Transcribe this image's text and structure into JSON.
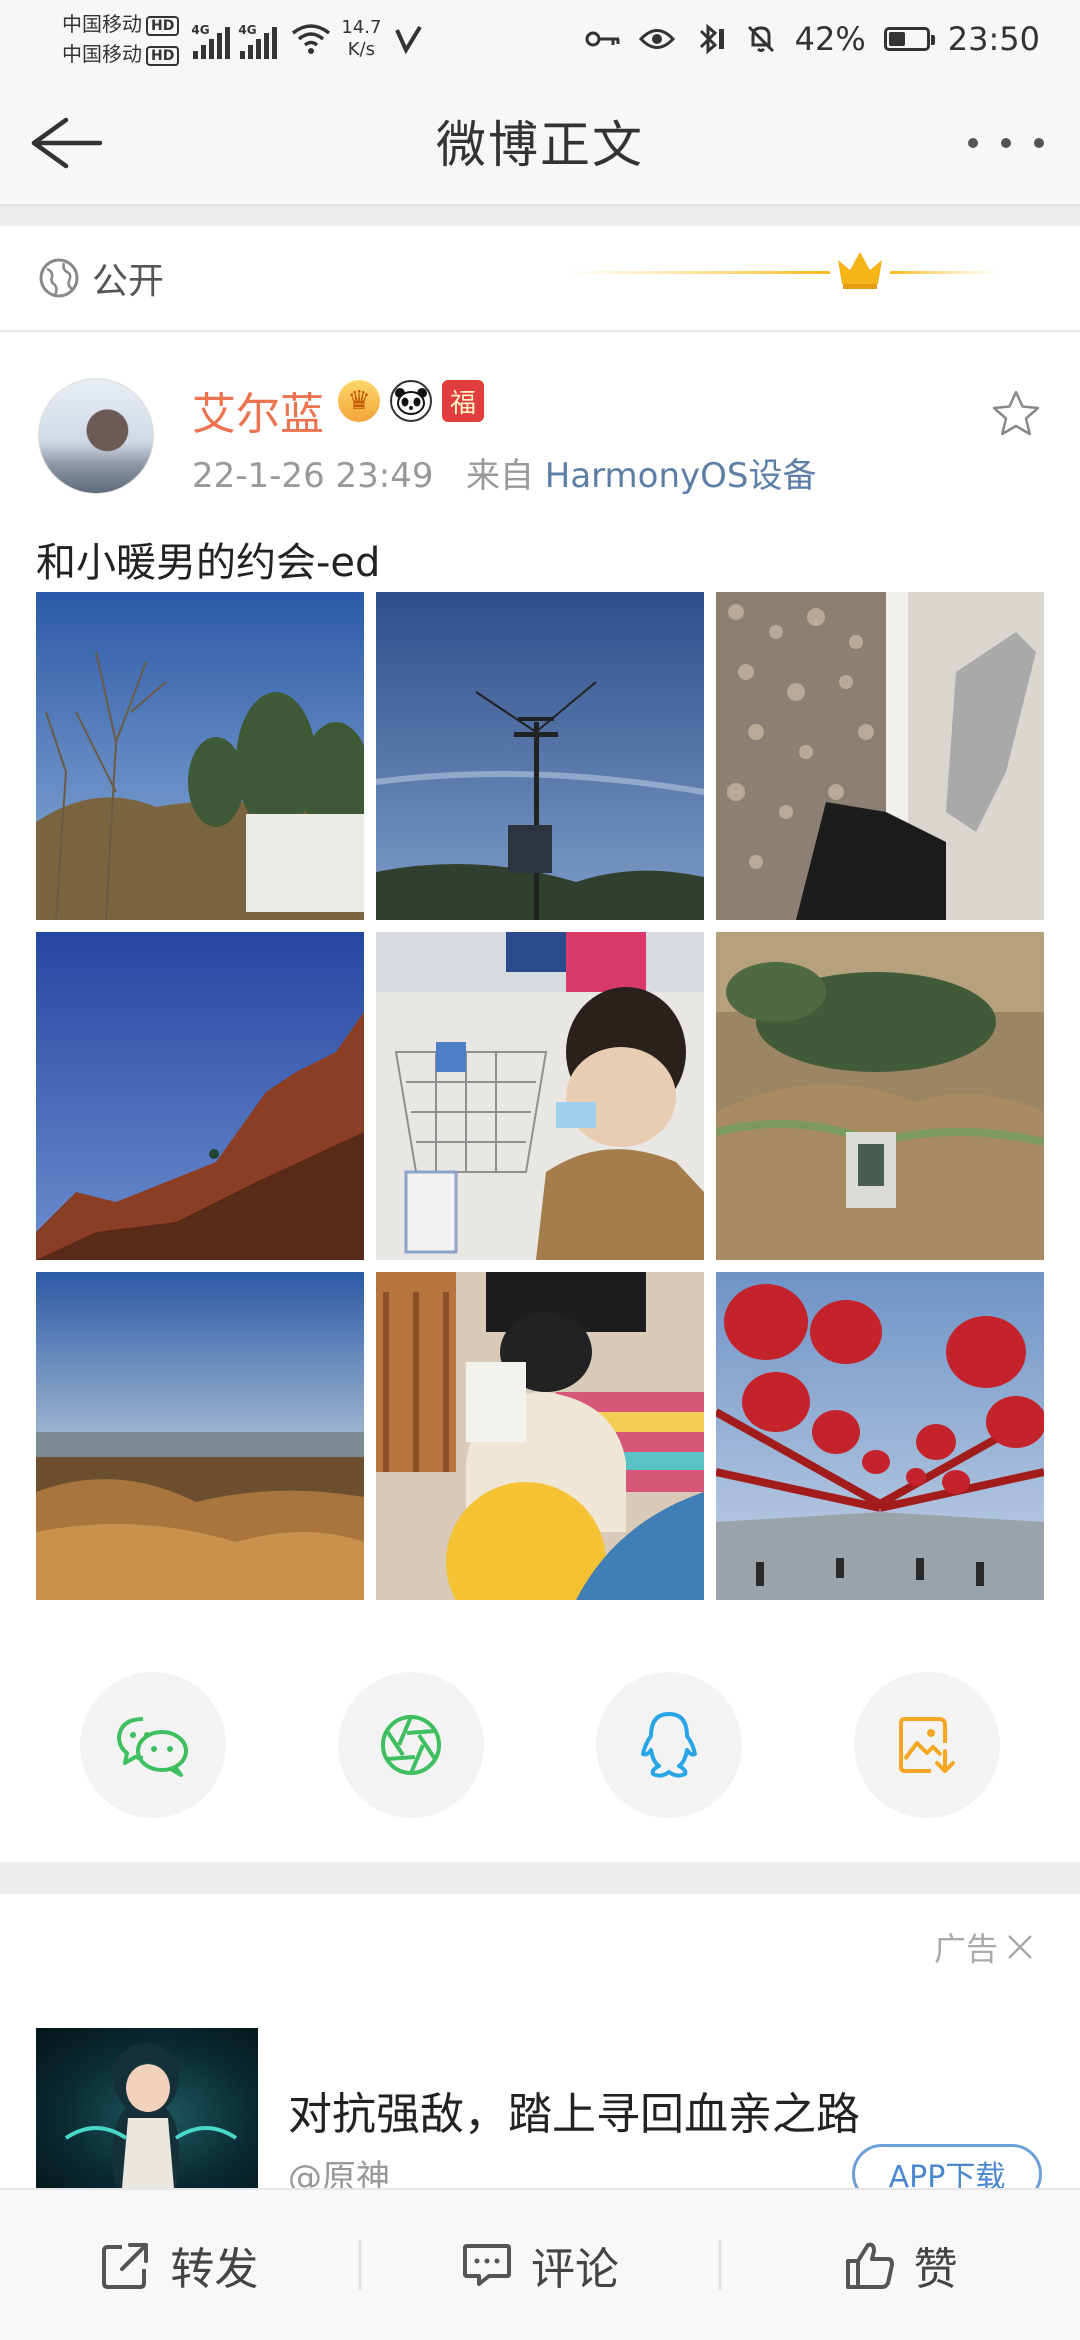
{
  "status_bar": {
    "carrier1": "中国移动",
    "carrier2": "中国移动",
    "hd": "HD",
    "sig_label": "4G",
    "net_speed_value": "14.7",
    "net_speed_unit": "K/s",
    "battery_percent": "42%",
    "battery_level": 0.42,
    "time": "23:50"
  },
  "nav": {
    "title": "微博正文"
  },
  "visibility": {
    "label": "公开"
  },
  "post": {
    "username": "艾尔蓝",
    "badge_vip": "♛",
    "badge_fu": "福",
    "timestamp": "22-1-26 23:49",
    "source_prefix": "来自",
    "source": "HarmonyOS设备",
    "text": "和小暖男的约会-ed"
  },
  "ad": {
    "tag": "广告",
    "title": "对抗强敌，踏上寻回血亲之路",
    "account": "@原神",
    "cta": "APP下载"
  },
  "bottom_bar": {
    "repost": "转发",
    "comment": "评论",
    "like": "赞"
  },
  "colors": {
    "username": "#eb7350",
    "source_link": "#5d7fa6",
    "wechat_green": "#3fbf5f",
    "moments_green": "#3fbf5f",
    "qq_blue": "#27a5e4",
    "save_orange": "#f5a623"
  }
}
